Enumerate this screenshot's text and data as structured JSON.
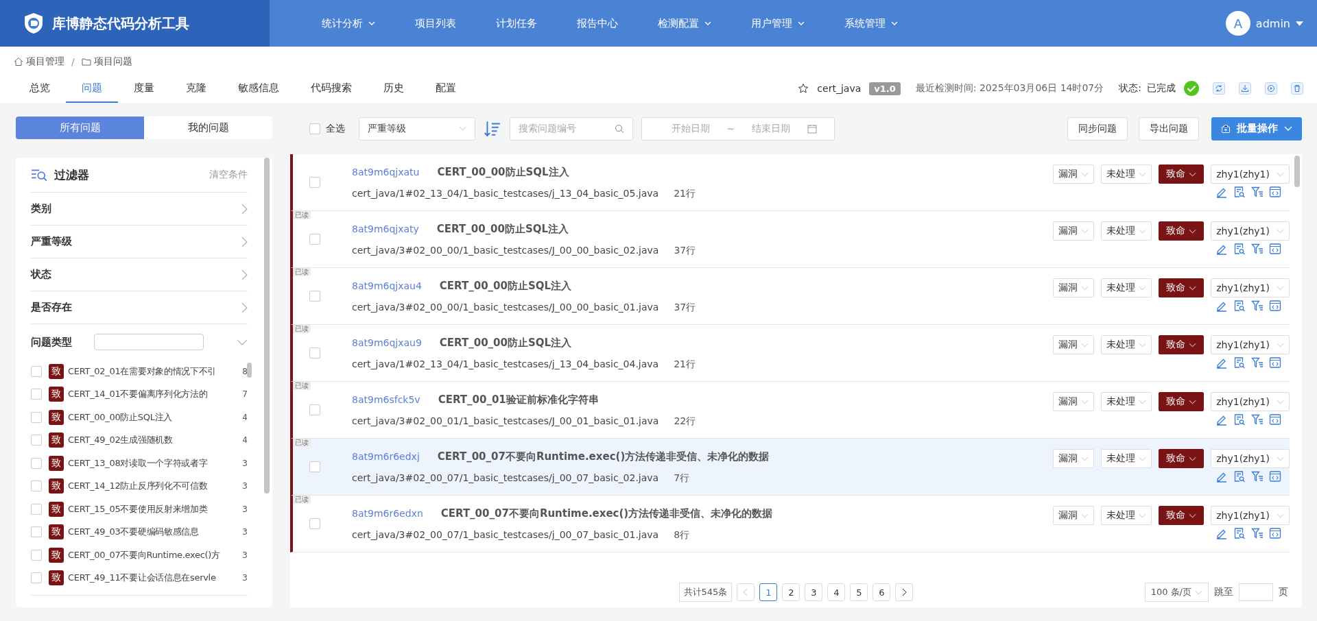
{
  "app": {
    "title": "库博静态代码分析工具"
  },
  "nav": [
    {
      "label": "统计分析",
      "dropdown": true
    },
    {
      "label": "项目列表",
      "dropdown": false
    },
    {
      "label": "计划任务",
      "dropdown": false
    },
    {
      "label": "报告中心",
      "dropdown": false
    },
    {
      "label": "检测配置",
      "dropdown": true
    },
    {
      "label": "用户管理",
      "dropdown": true
    },
    {
      "label": "系统管理",
      "dropdown": true
    }
  ],
  "user": {
    "avatar": "A",
    "name": "admin"
  },
  "breadcrumb": {
    "items": [
      "项目管理",
      "项目问题"
    ],
    "separator": "/"
  },
  "tabs": [
    {
      "label": "总览",
      "selected": false
    },
    {
      "label": "问题",
      "selected": true
    },
    {
      "label": "度量",
      "selected": false
    },
    {
      "label": "克隆",
      "selected": false
    },
    {
      "label": "敏感信息",
      "selected": false
    },
    {
      "label": "代码搜索",
      "selected": false
    },
    {
      "label": "历史",
      "selected": false
    },
    {
      "label": "配置",
      "selected": false
    }
  ],
  "project": {
    "name": "cert_java",
    "version": "v1.0",
    "last_check": "最近检测时间: 2025年03月06日 14时07分",
    "status_label": "状态:",
    "status": "已完成"
  },
  "scope": [
    {
      "label": "所有问题",
      "selected": true
    },
    {
      "label": "我的问题",
      "selected": false
    }
  ],
  "filter": {
    "title": "过滤器",
    "clear": "清空条件",
    "sections": [
      "类别",
      "严重等级",
      "状态",
      "是否存在"
    ],
    "type_label": "问题类型",
    "types": [
      {
        "badge": "致",
        "name": "CERT_02_01在需要对象的情况下不引",
        "count": "8",
        "checked": false
      },
      {
        "badge": "致",
        "name": "CERT_14_01不要偏离序列化方法的",
        "count": "7",
        "checked": false
      },
      {
        "badge": "致",
        "name": "CERT_00_00防止SQL注入",
        "count": "4",
        "checked": false
      },
      {
        "badge": "致",
        "name": "CERT_49_02生成强随机数",
        "count": "4",
        "checked": false
      },
      {
        "badge": "致",
        "name": "CERT_13_08对读取一个字符或者字",
        "count": "3",
        "checked": false
      },
      {
        "badge": "致",
        "name": "CERT_14_12防止反序列化不可信数",
        "count": "3",
        "checked": false
      },
      {
        "badge": "致",
        "name": "CERT_15_05不要使用反射来增加类",
        "count": "3",
        "checked": false
      },
      {
        "badge": "致",
        "name": "CERT_49_03不要硬编码敏感信息",
        "count": "3",
        "checked": false
      },
      {
        "badge": "致",
        "name": "CERT_00_07不要向Runtime.exec()方",
        "count": "3",
        "checked": false
      },
      {
        "badge": "致",
        "name": "CERT_49_11不要让会话信息在servle",
        "count": "3",
        "checked": false
      }
    ]
  },
  "toolbar": {
    "select_all": "全选",
    "select_all_checked": false,
    "severity_placeholder": "严重等级",
    "search_placeholder": "搜索问题编号",
    "start_placeholder": "开始日期",
    "range_sep": "~",
    "end_placeholder": "结束日期",
    "buttons": [
      "同步问题",
      "导出问题"
    ],
    "batch": "批量操作"
  },
  "issues": [
    {
      "id": "8at9m6qjxatu",
      "rule": "CERT_00_00",
      "title": "防止SQL注入",
      "path": "cert_java/1#02_13_04/1_basic_testcases/j_13_04_basic_05.java",
      "lines": "21行",
      "category": "漏洞",
      "state": "未处理",
      "severity": "致命",
      "assignee": "zhy1(zhy1)",
      "selected": false,
      "checked": false
    },
    {
      "id": "8at9m6qjxaty",
      "rule": "CERT_00_00",
      "title": "防止SQL注入",
      "path": "cert_java/3#02_00_00/1_basic_testcases/J_00_00_basic_02.java",
      "lines": "37行",
      "read_tag": "已读",
      "category": "漏洞",
      "state": "未处理",
      "severity": "致命",
      "assignee": "zhy1(zhy1)",
      "selected": false,
      "checked": false
    },
    {
      "id": "8at9m6qjxau4",
      "rule": "CERT_00_00",
      "title": "防止SQL注入",
      "path": "cert_java/3#02_00_00/1_basic_testcases/J_00_00_basic_01.java",
      "lines": "37行",
      "read_tag": "已读",
      "category": "漏洞",
      "state": "未处理",
      "severity": "致命",
      "assignee": "zhy1(zhy1)",
      "selected": false,
      "checked": false
    },
    {
      "id": "8at9m6qjxau9",
      "rule": "CERT_00_00",
      "title": "防止SQL注入",
      "path": "cert_java/1#02_13_04/1_basic_testcases/j_13_04_basic_04.java",
      "lines": "21行",
      "read_tag": "已读",
      "category": "漏洞",
      "state": "未处理",
      "severity": "致命",
      "assignee": "zhy1(zhy1)",
      "selected": false,
      "checked": false
    },
    {
      "id": "8at9m6sfck5v",
      "rule": "CERT_00_01",
      "title": "验证前标准化字符串",
      "path": "cert_java/3#02_00_01/1_basic_testcases/J_00_01_basic_01.java",
      "lines": "22行",
      "read_tag": "已读",
      "category": "漏洞",
      "state": "未处理",
      "severity": "致命",
      "assignee": "zhy1(zhy1)",
      "selected": false,
      "checked": false
    },
    {
      "id": "8at9m6r6edxj",
      "rule": "CERT_00_07",
      "title": "不要向Runtime.exec()方法传递非受信、未净化的数据",
      "path": "cert_java/3#02_00_07/1_basic_testcases/j_00_07_basic_02.java",
      "lines": "7行",
      "read_tag": "已读",
      "category": "漏洞",
      "state": "未处理",
      "severity": "致命",
      "assignee": "zhy1(zhy1)",
      "selected": true,
      "checked": false
    },
    {
      "id": "8at9m6r6edxn",
      "rule": "CERT_00_07",
      "title": "不要向Runtime.exec()方法传递非受信、未净化的数据",
      "path": "cert_java/3#02_00_07/1_basic_testcases/j_00_07_basic_01.java",
      "lines": "8行",
      "read_tag": "已读",
      "category": "漏洞",
      "state": "未处理",
      "severity": "致命",
      "assignee": "zhy1(zhy1)",
      "selected": false,
      "checked": false
    }
  ],
  "pagination": {
    "total": "共计545条",
    "pages": [
      {
        "label": "1",
        "selected": true
      },
      {
        "label": "2",
        "selected": false
      },
      {
        "label": "3",
        "selected": false
      },
      {
        "label": "4",
        "selected": false
      },
      {
        "label": "5",
        "selected": false
      },
      {
        "label": "6",
        "selected": false
      }
    ],
    "page_size": "100 条/页",
    "jump_label": "跳至",
    "jump_suffix": "页"
  }
}
